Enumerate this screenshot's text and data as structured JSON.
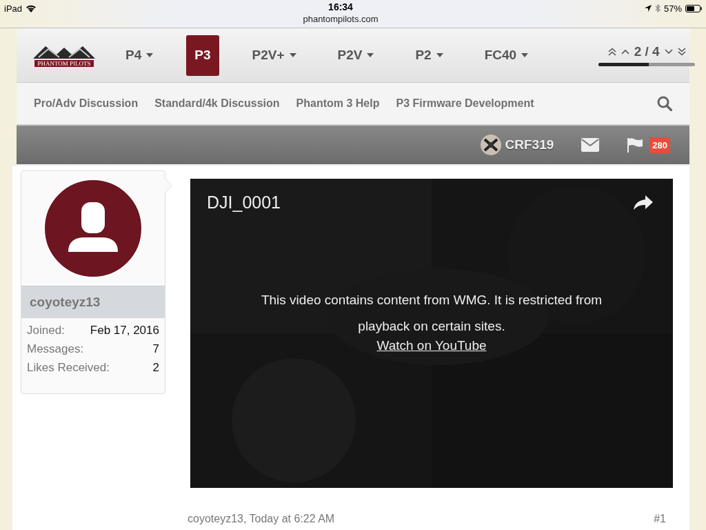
{
  "status_bar": {
    "device": "iPad",
    "time": "16:34",
    "url": "phantompilots.com",
    "battery": "57%"
  },
  "nav": {
    "logo": "PHANTOM PILOTS",
    "items": [
      {
        "label": "P4",
        "selected": false,
        "dropdown": true
      },
      {
        "label": "P3",
        "selected": true,
        "dropdown": false
      },
      {
        "label": "P2V+",
        "selected": false,
        "dropdown": true
      },
      {
        "label": "P2V",
        "selected": false,
        "dropdown": true
      },
      {
        "label": "P2",
        "selected": false,
        "dropdown": true
      },
      {
        "label": "FC40",
        "selected": false,
        "dropdown": true
      }
    ],
    "page": "2 / 4",
    "level": 0.52
  },
  "subnav": [
    "Pro/Adv Discussion",
    "Standard/4k Discussion",
    "Phantom 3 Help",
    "P3 Firmware Development"
  ],
  "user_bar": {
    "username": "CRF319",
    "alerts": "280"
  },
  "post": {
    "author": "coyoteyz13",
    "stats": [
      {
        "label": "Joined:",
        "value": "Feb 17, 2016"
      },
      {
        "label": "Messages:",
        "value": "7"
      },
      {
        "label": "Likes Received:",
        "value": "2"
      }
    ],
    "video": {
      "title": "DJI_0001",
      "message": "This video contains content from WMG. It is restricted from playback on certain sites.",
      "link": "Watch on YouTube"
    },
    "meta": "coyoteyz13, Today at 6:22 AM",
    "number": "#1"
  }
}
